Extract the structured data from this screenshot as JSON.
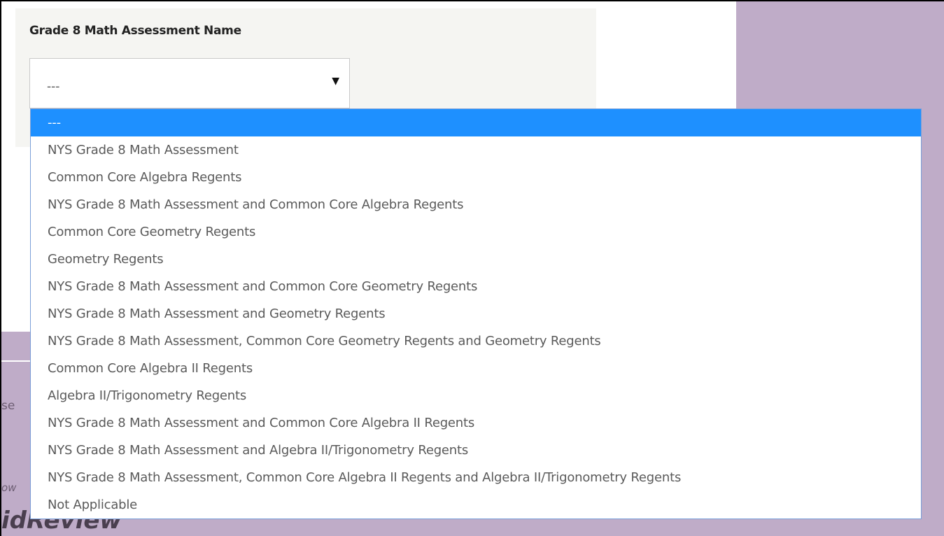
{
  "form": {
    "label": "Grade 8 Math Assessment Name",
    "select": {
      "value": "---",
      "arrow_icon": "caret-down-icon"
    }
  },
  "dropdown": {
    "selected_index": 0,
    "highlight_color": "#1e90ff",
    "options": [
      "---",
      "NYS Grade 8 Math Assessment",
      "Common Core Algebra Regents",
      "NYS Grade 8 Math Assessment and Common Core Algebra Regents",
      "Common Core Geometry Regents",
      "Geometry Regents",
      "NYS Grade 8 Math Assessment and Common Core Geometry Regents",
      "NYS Grade 8 Math Assessment and Geometry Regents",
      "NYS Grade 8 Math Assessment, Common Core Geometry Regents and Geometry Regents",
      "Common Core Algebra II Regents",
      "Algebra II/Trigonometry Regents",
      "NYS Grade 8 Math Assessment and Common Core Algebra II Regents",
      "NYS Grade 8 Math Assessment and Algebra II/Trigonometry Regents",
      "NYS Grade 8 Math Assessment, Common Core Algebra II Regents and Algebra II/Trigonometry Regents",
      "Not Applicable"
    ]
  },
  "background": {
    "color": "#bfacc8",
    "fragment_a": "se",
    "fragment_b": "ow",
    "fragment_c": "idReview"
  }
}
